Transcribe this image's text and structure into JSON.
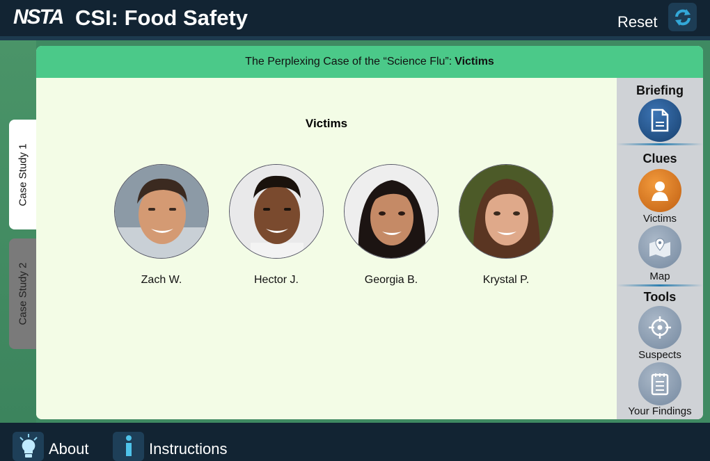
{
  "header": {
    "logo_text": "NSTA",
    "title": "CSI: Food Safety",
    "reset_label": "Reset"
  },
  "tabs": [
    {
      "label": "Case Study 1",
      "active": true
    },
    {
      "label": "Case Study 2",
      "active": false
    }
  ],
  "card": {
    "title_prefix": "The Perplexing Case of the “Science Flu”:",
    "title_bold": "Victims",
    "section_heading": "Victims",
    "victims": [
      {
        "name": "Zach W."
      },
      {
        "name": "Hector J."
      },
      {
        "name": "Georgia B."
      },
      {
        "name": "Krystal P."
      }
    ]
  },
  "panel": {
    "briefing_title": "Briefing",
    "clues_title": "Clues",
    "tools_title": "Tools",
    "victims_label": "Victims",
    "map_label": "Map",
    "suspects_label": "Suspects",
    "findings_label": "Your Findings"
  },
  "footer": {
    "about_label": "About",
    "instructions_label": "Instructions"
  },
  "colors": {
    "topbar": "#122433",
    "accent_green": "#4bc989",
    "active_orange": "#e07a22",
    "blue_button": "#1f4f86",
    "inactive_button": "#8397ad"
  }
}
